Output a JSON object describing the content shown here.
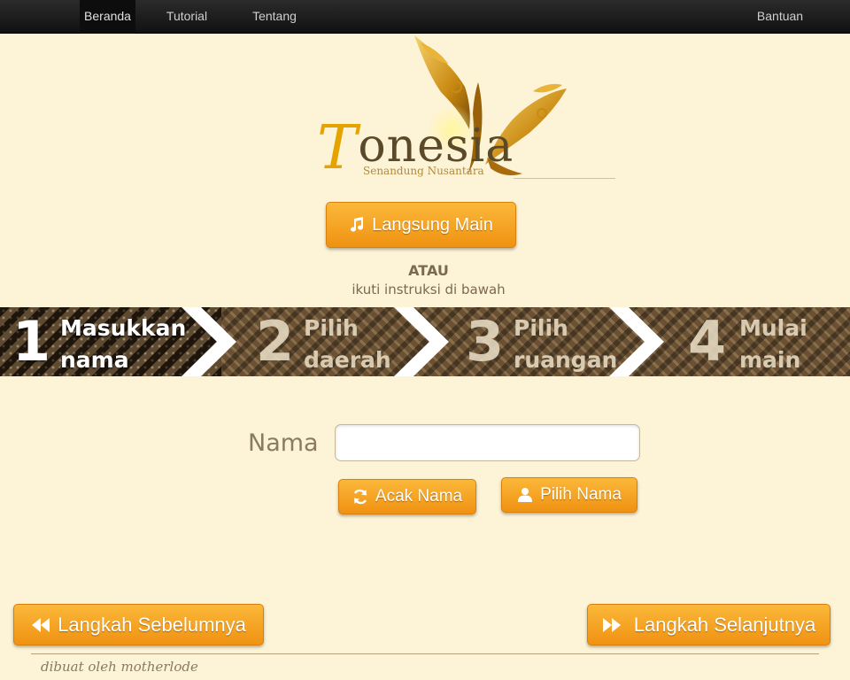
{
  "nav": {
    "items": [
      {
        "label": "Beranda"
      },
      {
        "label": "Tutorial"
      },
      {
        "label": "Tentang"
      }
    ],
    "help_label": "Bantuan"
  },
  "logo": {
    "title_first": "T",
    "title_rest": "onesia",
    "subtitle": "Senandung Nusantara"
  },
  "play_button": {
    "label": "Langsung Main"
  },
  "or": {
    "label": "ATAU",
    "instruction": "ikuti instruksi di bawah"
  },
  "steps": [
    {
      "number": "1",
      "label": "Masukkan\nnama",
      "active": true
    },
    {
      "number": "2",
      "label": "Pilih\ndaerah",
      "active": false
    },
    {
      "number": "3",
      "label": "Pilih\nruangan",
      "active": false
    },
    {
      "number": "4",
      "label": "Mulai\nmain",
      "active": false
    }
  ],
  "form": {
    "name_label": "Nama",
    "name_value": "",
    "random_button": "Acak Nama",
    "choose_button": "Pilih Nama"
  },
  "navigation": {
    "prev_label": "Langkah Sebelumnya",
    "next_label": "Langkah Selanjutnya"
  },
  "footer": {
    "text": "dibuat oleh motherlode"
  },
  "colors": {
    "background": "#fdf3d7",
    "button": "#f5a623",
    "navbar": "#1a1a1a",
    "text_muted": "#8a7a60"
  }
}
